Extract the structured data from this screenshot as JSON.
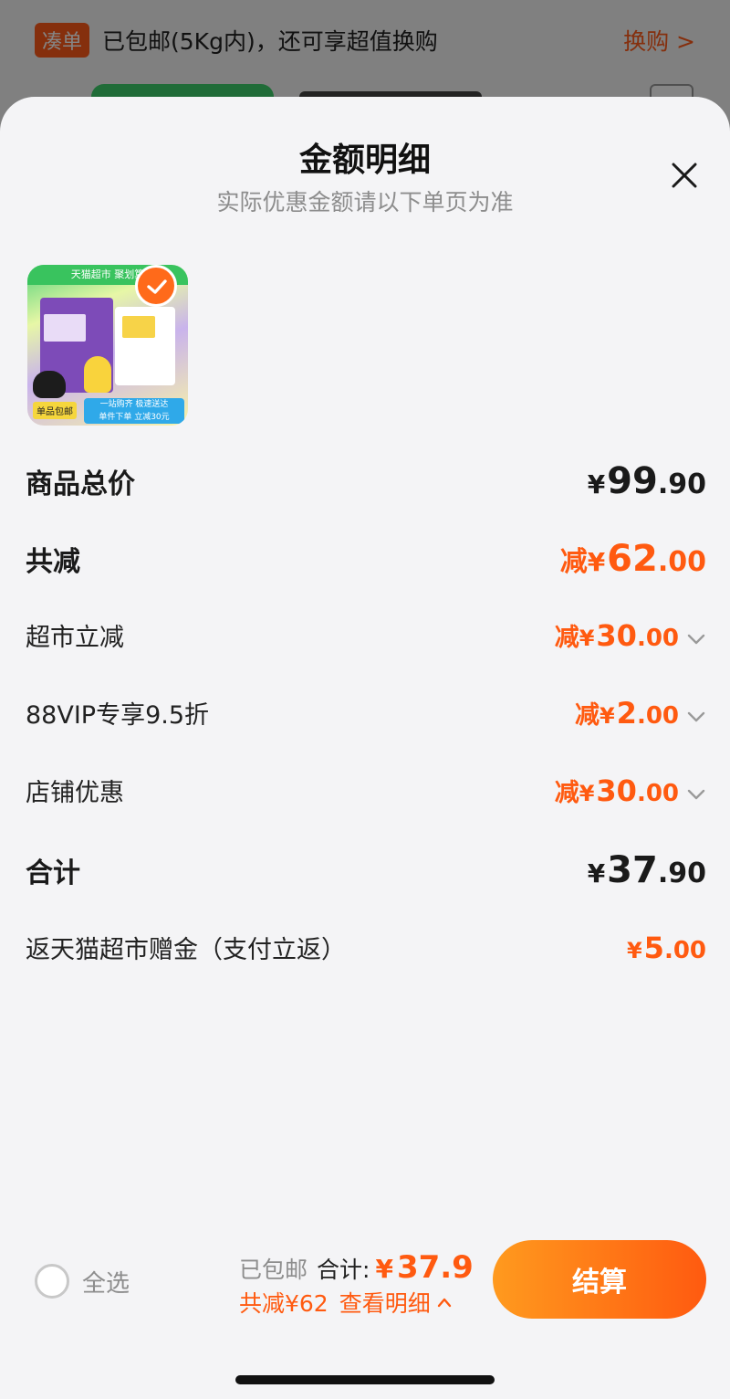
{
  "background": {
    "tag": "凑单",
    "text": "已包邮(5Kg内)，还可享超值换购",
    "link": "换购 >"
  },
  "sheet": {
    "title": "金额明细",
    "subtitle": "实际优惠金额请以下单页为准"
  },
  "product": {
    "banner": "天猫超市 聚划算",
    "tag": "单品包邮",
    "strip_top": "一站购齐 极速送达",
    "strip_bottom": "单件下单 立减30元",
    "selected": true
  },
  "rows": {
    "goods_total": {
      "label": "商品总价",
      "yen": "¥",
      "int": "99",
      "dec": ".90"
    },
    "total_discount": {
      "label": "共减",
      "prefix": "减",
      "yen": "¥",
      "int": "62",
      "dec": ".00"
    },
    "discounts": [
      {
        "label": "超市立减",
        "prefix": "减",
        "yen": "¥",
        "int": "30",
        "dec": ".00"
      },
      {
        "label": "88VIP专享9.5折",
        "prefix": "减",
        "yen": "¥",
        "int": "2",
        "dec": ".00"
      },
      {
        "label": "店铺优惠",
        "prefix": "减",
        "yen": "¥",
        "int": "30",
        "dec": ".00"
      }
    ],
    "sum": {
      "label": "合计",
      "yen": "¥",
      "int": "37",
      "dec": ".90"
    },
    "rebate": {
      "label": "返天猫超市赠金（支付立返）",
      "yen": "¥",
      "int": "5",
      "dec": ".00"
    }
  },
  "bottom_bar": {
    "select_all": "全选",
    "free_shipping": "已包邮",
    "total_label": "合计:",
    "total_yen": "¥",
    "total_value": "37.9",
    "discount_text": "共减¥62",
    "view_detail": "查看明细",
    "checkout": "结算"
  },
  "colors": {
    "accent": "#ff5a10",
    "accent_gradient_start": "#ff9a1e",
    "sheet_background": "#f4f4f6"
  },
  "icons": {
    "close": "close-icon",
    "chevron_down": "chevron-down-icon",
    "chevron_up": "chevron-up-icon",
    "check": "check-icon"
  }
}
